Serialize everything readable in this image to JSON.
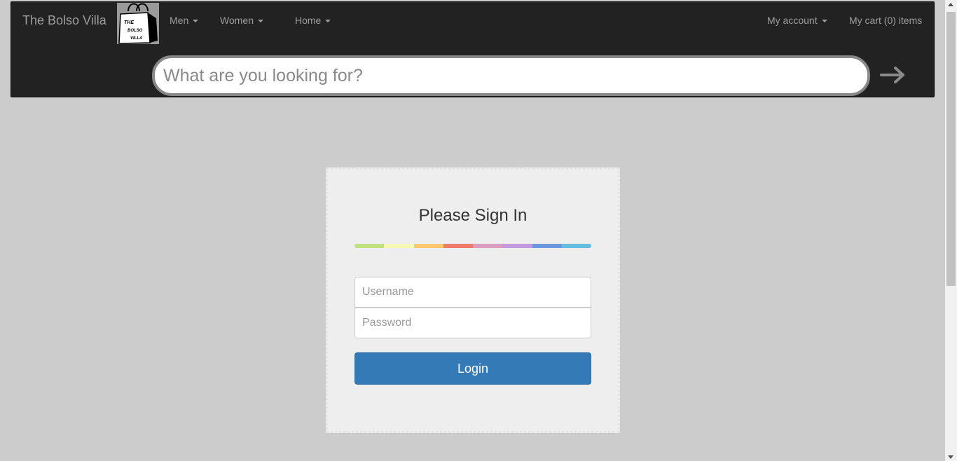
{
  "navbar": {
    "brand": "The Bolso Villa",
    "logo_text": [
      "THE",
      "BOLSO",
      "VILLA"
    ],
    "menu": {
      "men": "Men",
      "women": "Women",
      "home": "Home",
      "account": "My account",
      "cart": "My cart (0) items"
    },
    "search": {
      "placeholder": "What are you looking for?",
      "value": ""
    }
  },
  "login": {
    "title": "Please Sign In",
    "username_placeholder": "Username",
    "password_placeholder": "Password",
    "button_label": "Login",
    "stripe_colors": [
      "#c1e283",
      "#f7f8b7",
      "#fcc871",
      "#ed7b6b",
      "#dc9ec0",
      "#c49ade",
      "#6b98db",
      "#67bde0"
    ]
  },
  "colors": {
    "background": "#cccccc",
    "navbar": "#222222",
    "primary": "#337ab7"
  }
}
